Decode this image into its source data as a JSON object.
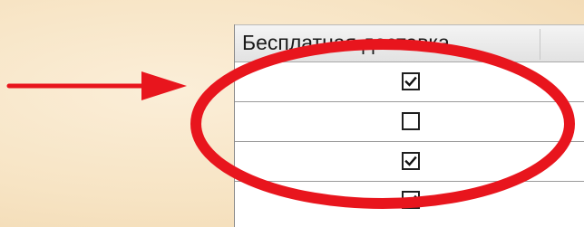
{
  "table": {
    "column_header": "Бесплатная доставка",
    "rows": [
      {
        "checked": true
      },
      {
        "checked": false
      },
      {
        "checked": true
      },
      {
        "checked": true
      }
    ]
  },
  "annotation": {
    "arrow_icon": "right-arrow-icon",
    "highlight_icon": "ellipse-highlight-icon",
    "color": "#e8151d"
  }
}
